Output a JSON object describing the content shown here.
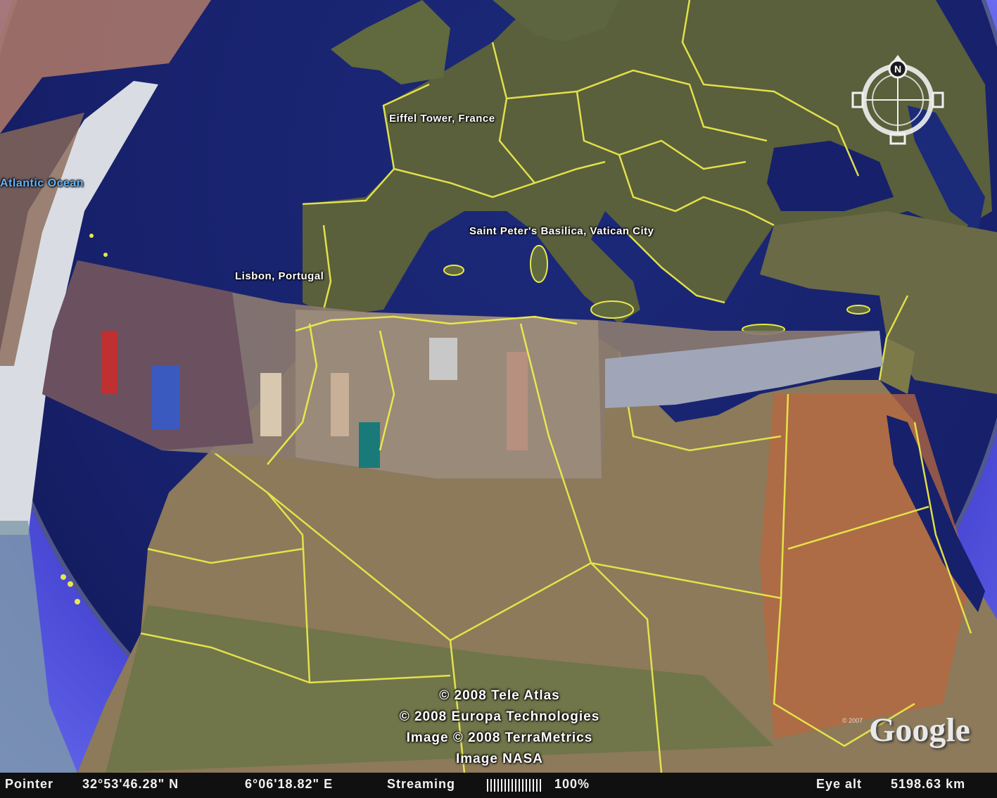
{
  "map": {
    "labels": {
      "atlantic": "Atlantic Ocean",
      "eiffel": "Eiffel Tower, France",
      "vatican": "Saint Peter's Basilica, Vatican City",
      "lisbon": "Lisbon, Portugal"
    },
    "credits": [
      "© 2008 Tele Atlas",
      "© 2008 Europa Technologies",
      "Image © 2008 TerraMetrics",
      "Image NASA"
    ],
    "logo": "Google",
    "logo_small": "© 2007",
    "compass_north": "N",
    "colors": {
      "ocean": "#17206a",
      "border": "#e8e84a",
      "sky": "#4a47d6"
    }
  },
  "statusbar": {
    "pointer_label": "Pointer",
    "latitude": "32°53'46.28\" N",
    "longitude": "6°06'18.82\" E",
    "streaming_label": "Streaming",
    "streaming_percent": "100%",
    "eye_alt_label": "Eye alt",
    "eye_alt_value": "5198.63 km"
  }
}
